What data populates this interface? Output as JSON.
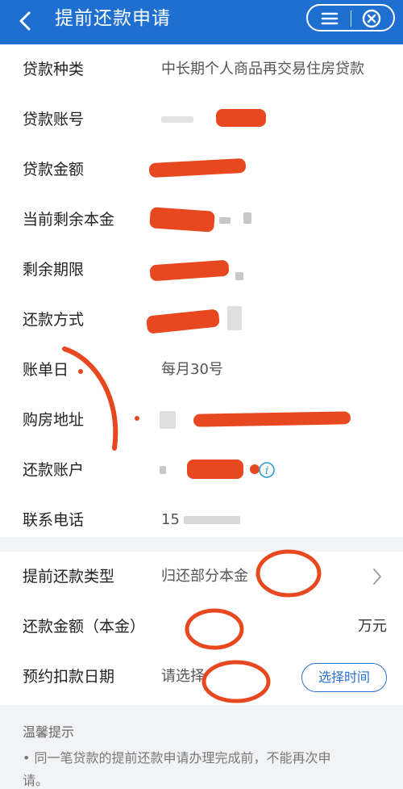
{
  "header": {
    "title": "提前还款申请",
    "back_icon": "chevron-left-icon",
    "menu_icon": "menu-icon",
    "close_icon": "close-circle-icon",
    "bg_color": "#1f6fd1"
  },
  "loan_info": [
    {
      "label": "贷款种类",
      "value": "中长期个人商品再交易住房贷款"
    },
    {
      "label": "贷款账号",
      "value": ""
    },
    {
      "label": "贷款金额",
      "value": ""
    },
    {
      "label": "当前剩余本金",
      "value": ""
    },
    {
      "label": "剩余期限",
      "value": ""
    },
    {
      "label": "还款方式",
      "value": ""
    },
    {
      "label": "账单日",
      "value": "每月30号"
    },
    {
      "label": "购房地址",
      "value": ""
    },
    {
      "label": "还款账户",
      "value": ""
    },
    {
      "label": "联系电话",
      "value": "15"
    }
  ],
  "form": {
    "type_label": "提前还款类型",
    "type_value": "归还部分本金",
    "amount_label": "还款金额（本金）",
    "amount_unit": "万元",
    "date_label": "预约扣款日期",
    "date_placeholder": "请选择",
    "select_time_button": "选择时间"
  },
  "tips": {
    "title": "温馨提示",
    "line1": "• 同一笔贷款的提前还款申请办理完成前，不能再次申",
    "line2": "请。"
  },
  "accent_color": "#2a73d3",
  "annotation_color": "#e8481f"
}
